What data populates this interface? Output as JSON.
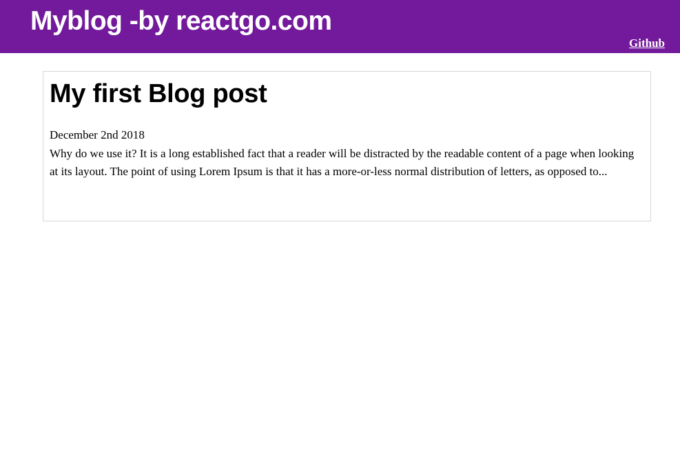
{
  "header": {
    "site_title": "Myblog -by reactgo.com",
    "github_label": "Github",
    "background_color": "#721a9b"
  },
  "post": {
    "title": "My first Blog post",
    "date": "December 2nd 2018",
    "excerpt": "Why do we use it? It is a long established fact that a reader will be distracted by the readable content of a page when looking at its layout. The point of using Lorem Ipsum is that it has a more-or-less normal distribution of letters, as opposed to..."
  }
}
